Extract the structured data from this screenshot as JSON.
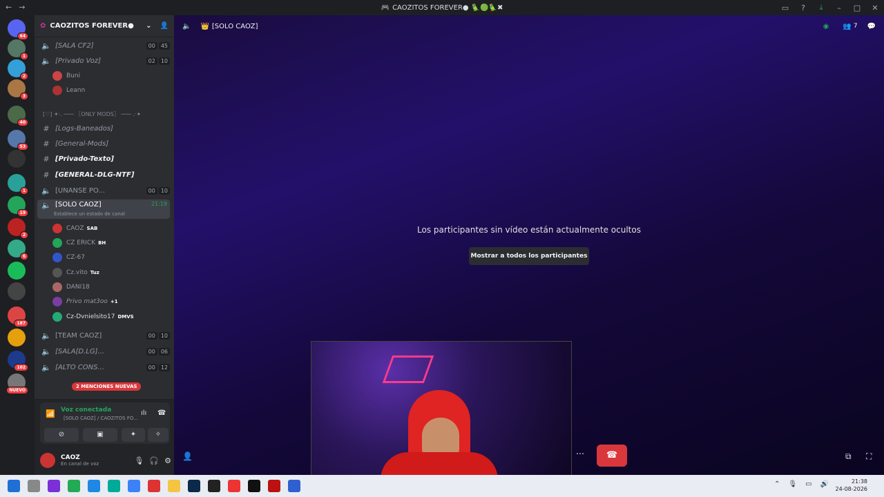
{
  "titlebar": {
    "title": "CAOZITOS FOREVER●",
    "title_emoji": "🦜🟢🦜✖"
  },
  "servers": [
    {
      "badge": "64",
      "color": "#5865f2"
    },
    {
      "badge": "1",
      "color": "#557766"
    },
    {
      "badge": "2",
      "color": "#33a0d8"
    },
    {
      "badge": "3",
      "color": "#aa7744"
    },
    {
      "badge": "40",
      "color": "#4a6a4a"
    },
    {
      "badge": "53",
      "color": "#5577aa"
    },
    {
      "badge": "",
      "color": "#333"
    },
    {
      "badge": "1",
      "color": "#2aa198"
    },
    {
      "badge": "19",
      "color": "#23a55a"
    },
    {
      "badge": "2",
      "color": "#b22"
    },
    {
      "badge": "6",
      "color": "#3a8"
    },
    {
      "badge": "",
      "color": "#1abc5a"
    },
    {
      "badge": "",
      "color": "#444"
    },
    {
      "badge": "187",
      "color": "#d44"
    },
    {
      "badge": "",
      "color": "#e5a00d"
    },
    {
      "badge": "102",
      "color": "#1e3a8a"
    },
    {
      "badge": "NUEVO",
      "color": "#777"
    }
  ],
  "sidebar": {
    "server_name": "CAOZITOS FOREVER●",
    "channels": [
      {
        "name": "[SALA CF2]",
        "icon": "🎮",
        "c1": "00",
        "c2": "45"
      },
      {
        "name": "[Privado Voz]",
        "icon": "⚙",
        "c1": "02",
        "c2": "10"
      }
    ],
    "users_a": [
      {
        "name": "Buni",
        "color": "#c44"
      },
      {
        "name": "Leann",
        "color": "#a33"
      }
    ],
    "category": "[♡] ✦·. ─── 〖ONLY MODS〗 ─── .·✦",
    "text_channels": [
      {
        "name": "[Logs-Baneados]",
        "icon": "⛔"
      },
      {
        "name": "[General-Mods]",
        "icon": "🔧"
      },
      {
        "name": "[Privado-Texto]",
        "icon": "⛔"
      },
      {
        "name": "[GENERAL-DLG-NTF]",
        "icon": "▬"
      }
    ],
    "unanse": {
      "name": "[UNANSE PO...",
      "c1": "00",
      "c2": "10"
    },
    "selected": {
      "name": "[SOLO CAOZ]",
      "timer": "21:19",
      "status": "Establece un estado de canal"
    },
    "users_b": [
      {
        "name": "CAOZ",
        "tag": "SAB",
        "color": "#c33"
      },
      {
        "name": "CZ ERICK",
        "tag": "BH",
        "color": "#23a55a"
      },
      {
        "name": "CZ-67",
        "tag": "",
        "color": "#3355cc"
      },
      {
        "name": "Cz.vito",
        "tag": "Tuz",
        "color": "#555"
      },
      {
        "name": "DANI18",
        "tag": "",
        "color": "#a66"
      },
      {
        "name": "Privo mat3oo",
        "tag": "+1",
        "color": "#7a3ea1"
      },
      {
        "name": "Cz-Dvnielsito17",
        "tag": "DMVS",
        "color": "#2a7"
      }
    ],
    "more_channels": [
      {
        "name": "[TEAM CAOZ]",
        "icon": "👑",
        "c1": "00",
        "c2": "10"
      },
      {
        "name": "[SALA[D.LG]...",
        "icon": "🔗",
        "c1": "00",
        "c2": "06"
      },
      {
        "name": "[ALTO CONS...",
        "icon": "🟡",
        "c1": "00",
        "c2": "12"
      }
    ],
    "mentions": "2 MENCIONES NUEVAS"
  },
  "voice": {
    "status": "Voz conectada",
    "channel": "[SOLO CAOZ] / CAOZITOS FO...",
    "user": "CAOZ",
    "user_status": "En canal de voz"
  },
  "stage": {
    "channel_title": "[SOLO CAOZ]",
    "member_count": "7",
    "hidden_msg": "Los participantes sin vídeo están actualmente ocultos",
    "show_all": "Mostrar a todos los participantes"
  },
  "taskbar": {
    "time": "21:38",
    "date": "24-08-2026"
  }
}
